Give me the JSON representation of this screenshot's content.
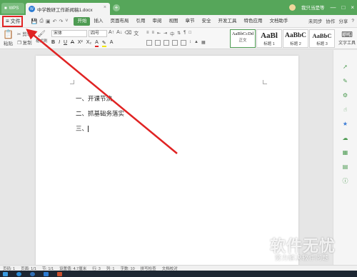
{
  "titlebar": {
    "wps_tab": "WPS",
    "doc_tab": "中学教研工作新闻稿1.docx",
    "new_tab": "+",
    "user": "我只当是等",
    "colors": {
      "bar": "#56a65a"
    }
  },
  "menubar": {
    "file_label": "文件",
    "items": [
      "开始",
      "插入",
      "页面布局",
      "引用",
      "审阅",
      "视图",
      "章节",
      "安全",
      "开发工具",
      "特色应用",
      "文档助手"
    ],
    "active_index": 0,
    "right_items": [
      "未同步",
      "协作",
      "分享",
      "搜索模板"
    ]
  },
  "ribbon": {
    "paste": "粘贴",
    "cut": "剪切",
    "copy": "复制",
    "format_painter": "格式刷",
    "font_name": "宋体",
    "font_size": "四号",
    "styles": [
      {
        "sample": "AaBbCcDd",
        "label": "正文"
      },
      {
        "sample": "AaBl",
        "label": "标题 1"
      },
      {
        "sample": "AaBbC",
        "label": "标题 2"
      },
      {
        "sample": "AaBbC",
        "label": "标题 3"
      }
    ],
    "text_tool": "文字工具"
  },
  "document": {
    "lines": [
      "一、开课节流",
      "二、抓基础务落实",
      "三、"
    ]
  },
  "statusbar": {
    "items": [
      "页码: 1",
      "页面: 1/1",
      "节: 1/1",
      "设置值: 4.7厘米",
      "行: 3",
      "列: 1",
      "字数: 10",
      "拼写检查",
      "文档校对"
    ]
  },
  "watermark": {
    "main": "软件无忧",
    "sub": "努力解决软件问题"
  },
  "annotation": {
    "color": "#e02323"
  }
}
